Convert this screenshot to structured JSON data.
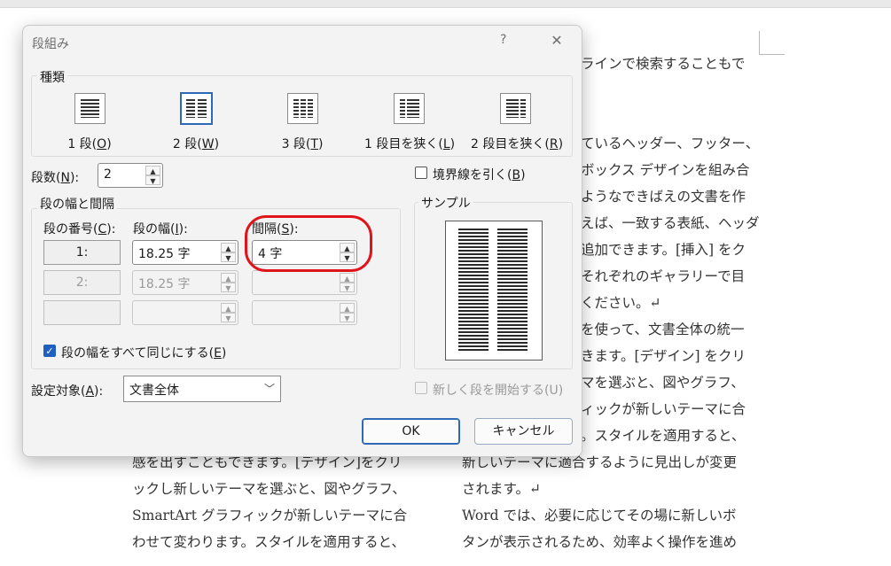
{
  "document": {
    "left_column": [
      {
        "text": "感を出すこともできます。[デザイン]をクリ"
      },
      {
        "text": "ックし新しいテーマを選ぶと、図やグラフ、"
      },
      {
        "text": "SmartArt グラフィックが新しいテーマに合"
      },
      {
        "text": "わせて変わります。スタイルを適用すると、"
      }
    ],
    "right_column": [
      {
        "text": "ラインで検索することもで"
      },
      {
        "text": ""
      },
      {
        "text": "ているヘッダー、フッター、"
      },
      {
        "text": "ボックス デザインを組み合"
      },
      {
        "text": "ようなできばえの文書を作"
      },
      {
        "text": "えば、一致する表紙、ヘッダ"
      },
      {
        "text": "追加できます。[挿入] をク"
      },
      {
        "text": "それぞれのギャラリーで目"
      },
      {
        "text": "ください。↵"
      },
      {
        "text": "を使って、文書全体の統一"
      },
      {
        "text": "きます。[デザイン] をクリ"
      },
      {
        "text": "マを選ぶと、図やグラフ、"
      },
      {
        "text": "ィックが新しいテーマに合"
      },
      {
        "text": "。スタイルを適用すると、"
      },
      {
        "text": "新しいテーマに適合するように見出しが変更"
      },
      {
        "text": "されます。↵"
      },
      {
        "text": "Word では、必要に応じてその場に新しいボ"
      },
      {
        "text": "タンが表示されるため、効率よく操作を進め"
      }
    ]
  },
  "dialog": {
    "title": "段組み",
    "help": "?",
    "close": "✕",
    "presets_group_label": "種類",
    "presets": [
      {
        "label_pre": "1 段(",
        "key": "O",
        "label_post": ")",
        "icon": "one-column-icon"
      },
      {
        "label_pre": "2 段(",
        "key": "W",
        "label_post": ")",
        "icon": "two-column-icon"
      },
      {
        "label_pre": "3 段(",
        "key": "T",
        "label_post": ")",
        "icon": "three-column-icon"
      },
      {
        "label_pre": "1 段目を狭く(",
        "key": "L",
        "label_post": ")",
        "icon": "left-narrow-icon"
      },
      {
        "label_pre": "2 段目を狭く(",
        "key": "R",
        "label_post": ")",
        "icon": "right-narrow-icon"
      }
    ],
    "num_columns": {
      "label_pre": "段数(",
      "key": "N",
      "label_post": "):",
      "value": "2"
    },
    "line_between": {
      "label_pre": "境界線を引く(",
      "key": "B",
      "label_post": ")"
    },
    "width_spacing": {
      "group_label": "段の幅と間隔",
      "col_number_header_pre": "段の番号(",
      "col_number_key": "C",
      "col_number_header_post": "):",
      "width_header_pre": "段の幅(",
      "width_key": "I",
      "width_header_post": "):",
      "spacing_header_pre": "間隔(",
      "spacing_key": "S",
      "spacing_header_post": "):",
      "rows": [
        {
          "number": "1:",
          "width": "18.25 字",
          "spacing": "4 字"
        },
        {
          "number": "2:",
          "width": "18.25 字",
          "spacing": ""
        },
        {
          "number": "",
          "width": "",
          "spacing": ""
        }
      ],
      "equal_width": {
        "label_pre": "段の幅をすべて同じにする(",
        "key": "E",
        "label_post": ")",
        "checked": true
      }
    },
    "sample": {
      "label": "サンプル"
    },
    "apply_to": {
      "label_pre": "設定対象(",
      "key": "A",
      "label_post": "):",
      "value": "文書全体"
    },
    "start_new_column": {
      "label": "新しく段を開始する(U)",
      "checked": false
    },
    "ok_label": "OK",
    "cancel_label": "キャンセル",
    "highlight_color": "#e0151b",
    "accent_color": "#2e69b5"
  }
}
